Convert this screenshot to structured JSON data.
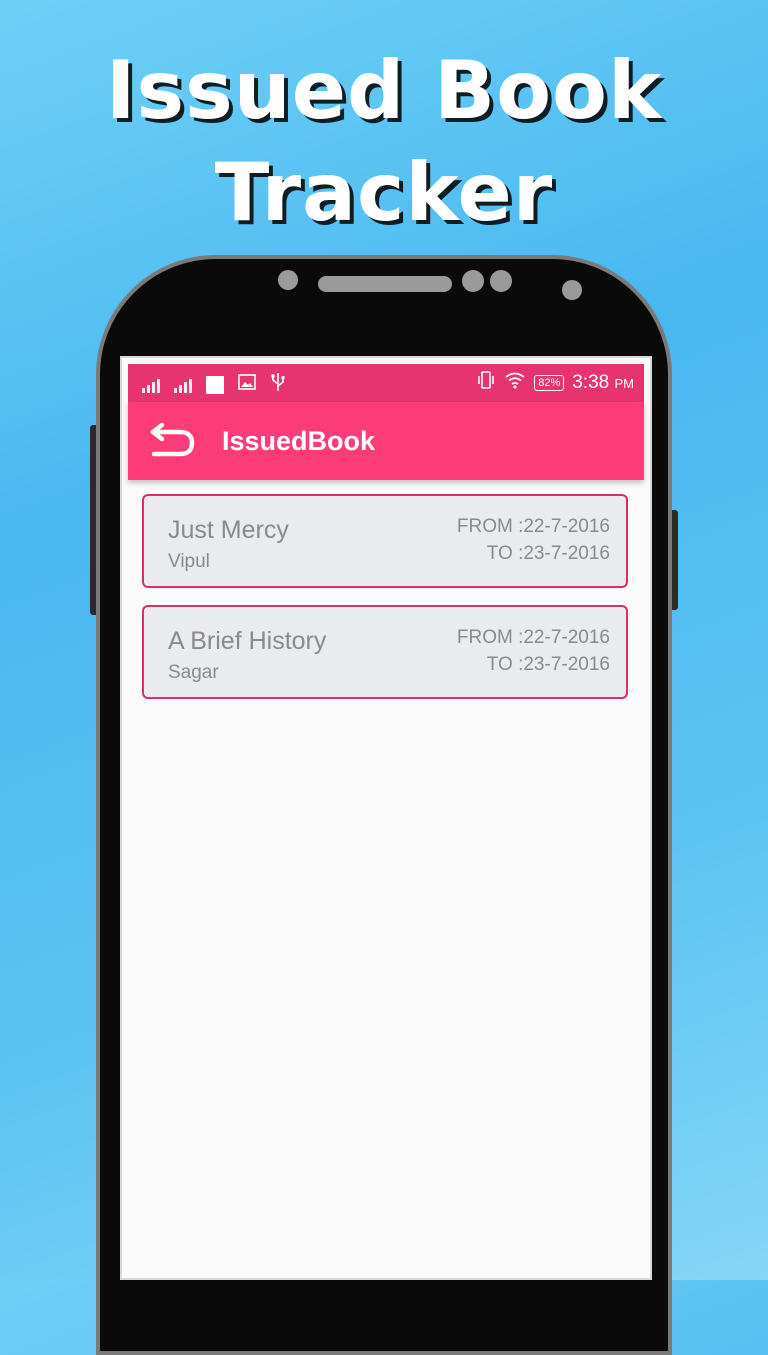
{
  "promo": {
    "title_line1": "Issued Book",
    "title_line2": "Tracker"
  },
  "status_bar": {
    "time": "3:38",
    "ampm": "PM",
    "battery": "82%",
    "icons": [
      "signal-icon",
      "signal-icon",
      "notification-square-icon",
      "image-icon",
      "usb-icon",
      "vibrate-icon",
      "wifi-icon",
      "battery-icon"
    ]
  },
  "app_bar": {
    "title": "IssuedBook",
    "back_icon": "back-arrow-icon"
  },
  "issued_books": [
    {
      "title": "Just Mercy",
      "person": "Vipul",
      "from": "FROM :22-7-2016",
      "to": "TO :23-7-2016"
    },
    {
      "title": "A Brief History",
      "person": "Sagar",
      "from": "FROM :22-7-2016",
      "to": "TO :23-7-2016"
    }
  ],
  "colors": {
    "accent": "#fb3c78",
    "status_bar": "#e7336f",
    "card_border": "#d62f6a",
    "card_bg": "#e9ebee",
    "background": "#49b8f0"
  }
}
